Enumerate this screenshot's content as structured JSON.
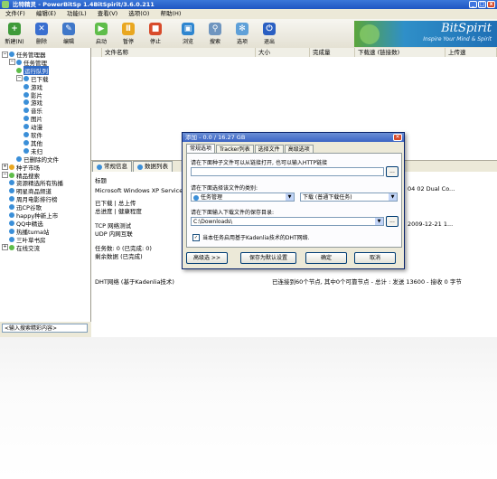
{
  "window": {
    "title": "比特精灵 - PowerBitSp 1.4BitSpirit/3.6.0.211"
  },
  "menu": [
    "文件(F)",
    "编辑(E)",
    "功能(L)",
    "查看(V)",
    "选项(O)",
    "帮助(H)"
  ],
  "toolbar": [
    {
      "label": "新建(N)",
      "icon": "new-icon",
      "color": "#3f9a3a",
      "glyph": "+"
    },
    {
      "label": "删除",
      "icon": "delete-icon",
      "color": "#3a6fd0",
      "glyph": "✕"
    },
    {
      "label": "编辑",
      "icon": "edit-icon",
      "color": "#3f77c9",
      "glyph": "✎"
    },
    {
      "label": "启动",
      "icon": "start-icon",
      "color": "#5fbd4a",
      "glyph": "▶"
    },
    {
      "label": "暂停",
      "icon": "pause-icon",
      "color": "#e9a721",
      "glyph": "Ⅱ"
    },
    {
      "label": "停止",
      "icon": "stop-icon",
      "color": "#d84b2b",
      "glyph": "■"
    },
    {
      "label": "浏览",
      "icon": "browse-icon",
      "color": "#2f86d0",
      "glyph": "▣"
    },
    {
      "label": "搜索",
      "icon": "search-icon",
      "color": "#6f95bf",
      "glyph": "⚲"
    },
    {
      "label": "选项",
      "icon": "options-icon",
      "color": "#5fa0d8",
      "glyph": "✻"
    },
    {
      "label": "退出",
      "icon": "exit-icon",
      "color": "#2a5fc2",
      "glyph": "⏻"
    }
  ],
  "logo": {
    "name": "BitSpirit",
    "slogan": "Inspire Your Mind & Spirit"
  },
  "tree": [
    {
      "label": "任务管理器",
      "level": 0,
      "color": "#3b8fd8",
      "expander": "−"
    },
    {
      "label": "任务管理",
      "level": 1,
      "color": "#3b8fd8",
      "expander": "−"
    },
    {
      "label": "运行队列",
      "level": 2,
      "color": "#5fbd4a",
      "selected": true
    },
    {
      "label": "已下载",
      "level": 2,
      "color": "#3b8fd8",
      "expander": "−"
    },
    {
      "label": "游戏",
      "level": 3,
      "color": "#3b8fd8"
    },
    {
      "label": "影片",
      "level": 3,
      "color": "#3b8fd8"
    },
    {
      "label": "游戏",
      "level": 3,
      "color": "#3b8fd8"
    },
    {
      "label": "音乐",
      "level": 3,
      "color": "#3b8fd8"
    },
    {
      "label": "图片",
      "level": 3,
      "color": "#3b8fd8"
    },
    {
      "label": "动漫",
      "level": 3,
      "color": "#3b8fd8"
    },
    {
      "label": "软件",
      "level": 3,
      "color": "#3b8fd8"
    },
    {
      "label": "其他",
      "level": 3,
      "color": "#3b8fd8"
    },
    {
      "label": "未归",
      "level": 3,
      "color": "#3b8fd8"
    },
    {
      "label": "已删除的文件",
      "level": 2,
      "color": "#3b8fd8"
    },
    {
      "label": "种子市场",
      "level": 0,
      "color": "#e9a721",
      "expander": "+"
    },
    {
      "label": "精品搜索",
      "level": 0,
      "color": "#5fbd4a",
      "expander": "−"
    },
    {
      "label": "资源精选所有热播",
      "level": 1,
      "color": "#3b8fd8"
    },
    {
      "label": "明星商品频道",
      "level": 1,
      "color": "#3b8fd8"
    },
    {
      "label": "周月电影排行榜",
      "level": 1,
      "color": "#3b8fd8"
    },
    {
      "label": "迅CP谷歌",
      "level": 1,
      "color": "#3b8fd8"
    },
    {
      "label": "happy种新上市",
      "level": 1,
      "color": "#3b8fd8"
    },
    {
      "label": "QQ中精选",
      "level": 1,
      "color": "#3b8fd8"
    },
    {
      "label": "热播tuma站",
      "level": 1,
      "color": "#3b8fd8"
    },
    {
      "label": "三叶草书房",
      "level": 1,
      "color": "#3b8fd8"
    },
    {
      "label": "在线交流",
      "level": 0,
      "color": "#5fbd4a",
      "expander": "+"
    }
  ],
  "tree_search": {
    "placeholder": "<输入搜索精彩内容>"
  },
  "list": {
    "columns": [
      "",
      "文件名称",
      "大小",
      "完成量",
      "下载速 (链接数)",
      "上传速"
    ]
  },
  "detail": {
    "tabs": [
      {
        "label": "常规信息"
      },
      {
        "label": "数据列表"
      }
    ],
    "rows_left": [
      "标题",
      "Microsoft Windows XP Service Pack 3 - 简体中文版",
      "已下载 | 总上传",
      "总进度 | 健康程度",
      "TCP 网络测试",
      "UDP 内网互联",
      "任务数: 0 (已完成: 0)",
      "剩余数据 (已完成)",
      "DHT网络 (基于Kadenlia技术)"
    ],
    "rows_right": [
      "04 02 Dual Co...",
      "2009-12-21 1...",
      "已连接到60个节点, 其中0个可靠节点 - 总计 : 发送 13600 - 接收 0 字节"
    ]
  },
  "dialog": {
    "title": "添加 - 0.0 / 16.27 GB",
    "tabs": [
      "常规选项",
      "Tracker列表",
      "选择文件",
      "高级选项"
    ],
    "url_label": "请在下面种子文件可以从链接打开, 也可以输入HTTP链接",
    "category_label": "请在下面选择该文件的类别:",
    "category_value": "任务管理",
    "mode_value": "下载 (普通下载任务)",
    "folder_label": "请在下面输入下载文件的保存目录:",
    "folder_value": "C:\\Downloads\\",
    "checkbox_label": "当本任务启用基于Kadenlia技术的DHT网络.",
    "btn_advanced": "高级选 >>",
    "btn_save_default": "保存为默认设置",
    "btn_ok": "确定",
    "btn_cancel": "取消",
    "browse_glyph": "...",
    "close_glyph": "✕"
  },
  "colors": {
    "title_bar": "#1f56c2",
    "accent": "#316ac5",
    "bg": "#ece9d8"
  }
}
